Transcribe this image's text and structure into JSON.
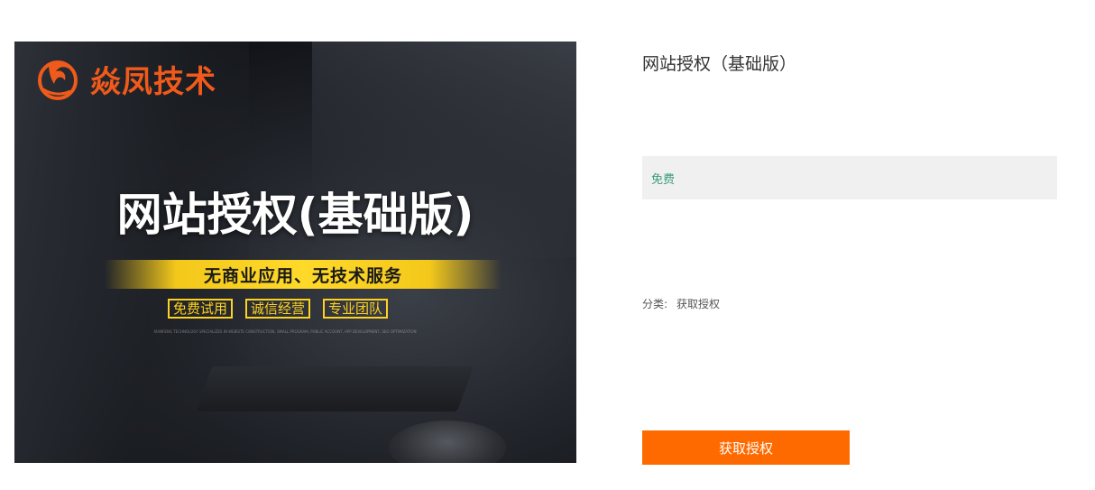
{
  "banner": {
    "logo_text": "焱凤技术",
    "headline": "网站授权(基础版)",
    "strip_text": "无商业应用、无技术服务",
    "badges": [
      "免费试用",
      "诚信经营",
      "专业团队"
    ],
    "fine_text": "XIANFENG TECHNOLOGY SPECIALIZES IN WEBSITE CONSTRUCTION, SMALL PROGRAM, PUBLIC ACCOUNT, APP DEVELOPMENT, SEO OPTIMIZATION",
    "logo_icon": "phoenix-icon",
    "colors": {
      "logo": "#f05a1a",
      "strip": "#ffd92a",
      "badge": "#ffd21f"
    }
  },
  "product": {
    "title": "网站授权（基础版）",
    "price": "免费",
    "category_label": "分类:",
    "category_value": "获取授权",
    "action_label": "获取授权"
  },
  "colors": {
    "price": "#3a9b7a",
    "button": "#ff6a00",
    "price_box": "#f0f0f0"
  }
}
